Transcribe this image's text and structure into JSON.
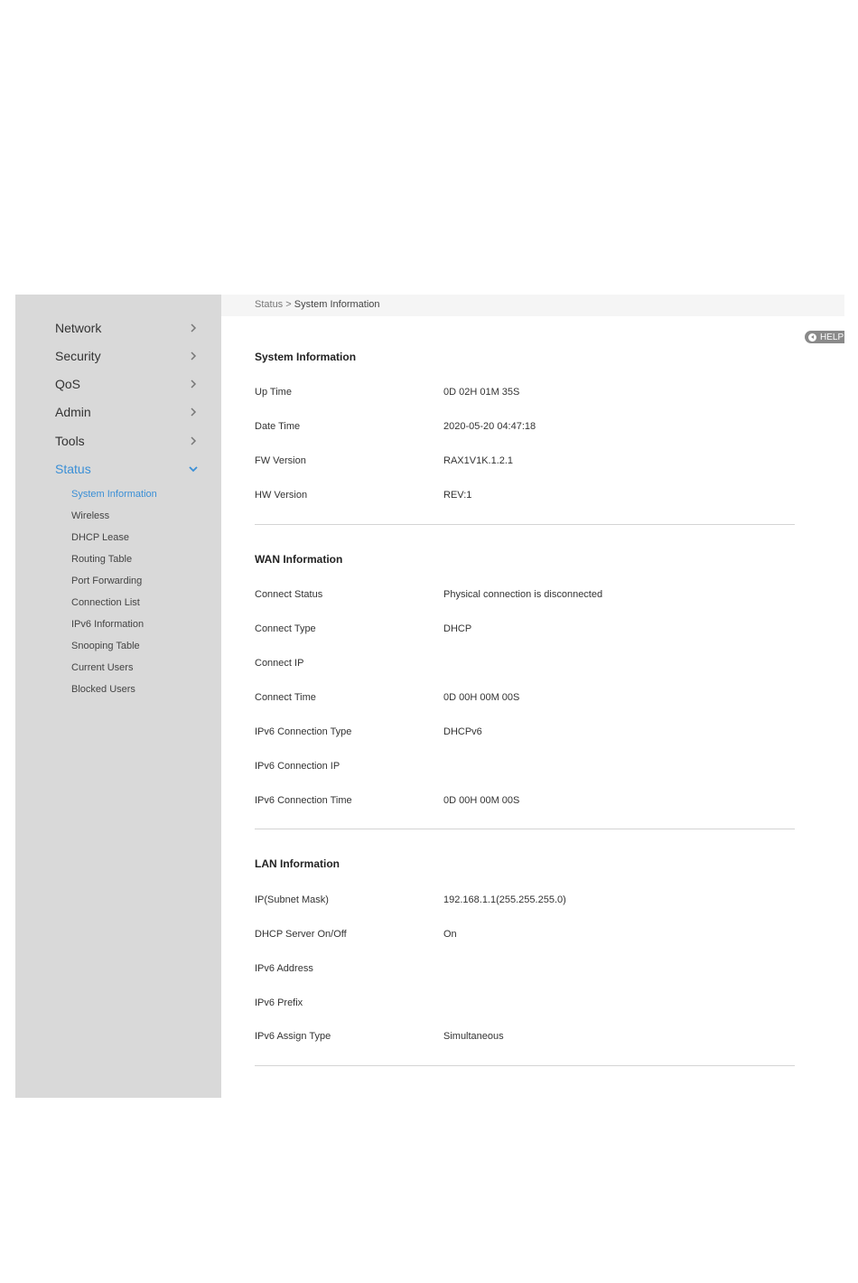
{
  "sidebar": {
    "nav": [
      {
        "label": "Network"
      },
      {
        "label": "Security"
      },
      {
        "label": "QoS"
      },
      {
        "label": "Admin"
      },
      {
        "label": "Tools"
      },
      {
        "label": "Status"
      }
    ],
    "status_sub": [
      {
        "label": "System Information"
      },
      {
        "label": "Wireless"
      },
      {
        "label": "DHCP Lease"
      },
      {
        "label": "Routing Table"
      },
      {
        "label": "Port Forwarding"
      },
      {
        "label": "Connection List"
      },
      {
        "label": "IPv6 Information"
      },
      {
        "label": "Snooping Table"
      },
      {
        "label": "Current Users"
      },
      {
        "label": "Blocked Users"
      }
    ]
  },
  "breadcrumb": {
    "parent": "Status",
    "separator": ">",
    "current": "System Information"
  },
  "help_label": "HELP",
  "sections": [
    {
      "title": "System Information",
      "rows": [
        {
          "label": "Up Time",
          "value": "0D 02H 01M 35S"
        },
        {
          "label": "Date Time",
          "value": "2020-05-20  04:47:18"
        },
        {
          "label": "FW Version",
          "value": "RAX1V1K.1.2.1"
        },
        {
          "label": "HW Version",
          "value": "REV:1"
        }
      ]
    },
    {
      "title": "WAN Information",
      "rows": [
        {
          "label": "Connect Status",
          "value": "Physical connection is disconnected"
        },
        {
          "label": "Connect Type",
          "value": "DHCP"
        },
        {
          "label": "Connect IP",
          "value": ""
        },
        {
          "label": "Connect Time",
          "value": "0D 00H 00M 00S"
        },
        {
          "label": "IPv6 Connection Type",
          "value": "DHCPv6"
        },
        {
          "label": "IPv6 Connection IP",
          "value": ""
        },
        {
          "label": "IPv6 Connection Time",
          "value": "0D 00H 00M 00S"
        }
      ]
    },
    {
      "title": "LAN Information",
      "rows": [
        {
          "label": "IP(Subnet Mask)",
          "value": "192.168.1.1(255.255.255.0)"
        },
        {
          "label": "DHCP Server On/Off",
          "value": "On"
        },
        {
          "label": "IPv6 Address",
          "value": ""
        },
        {
          "label": "IPv6 Prefix",
          "value": ""
        },
        {
          "label": "IPv6 Assign Type",
          "value": "Simultaneous"
        }
      ]
    }
  ],
  "colors": {
    "accent": "#3a8fd6",
    "sidebar_bg": "#d9d9d9"
  }
}
